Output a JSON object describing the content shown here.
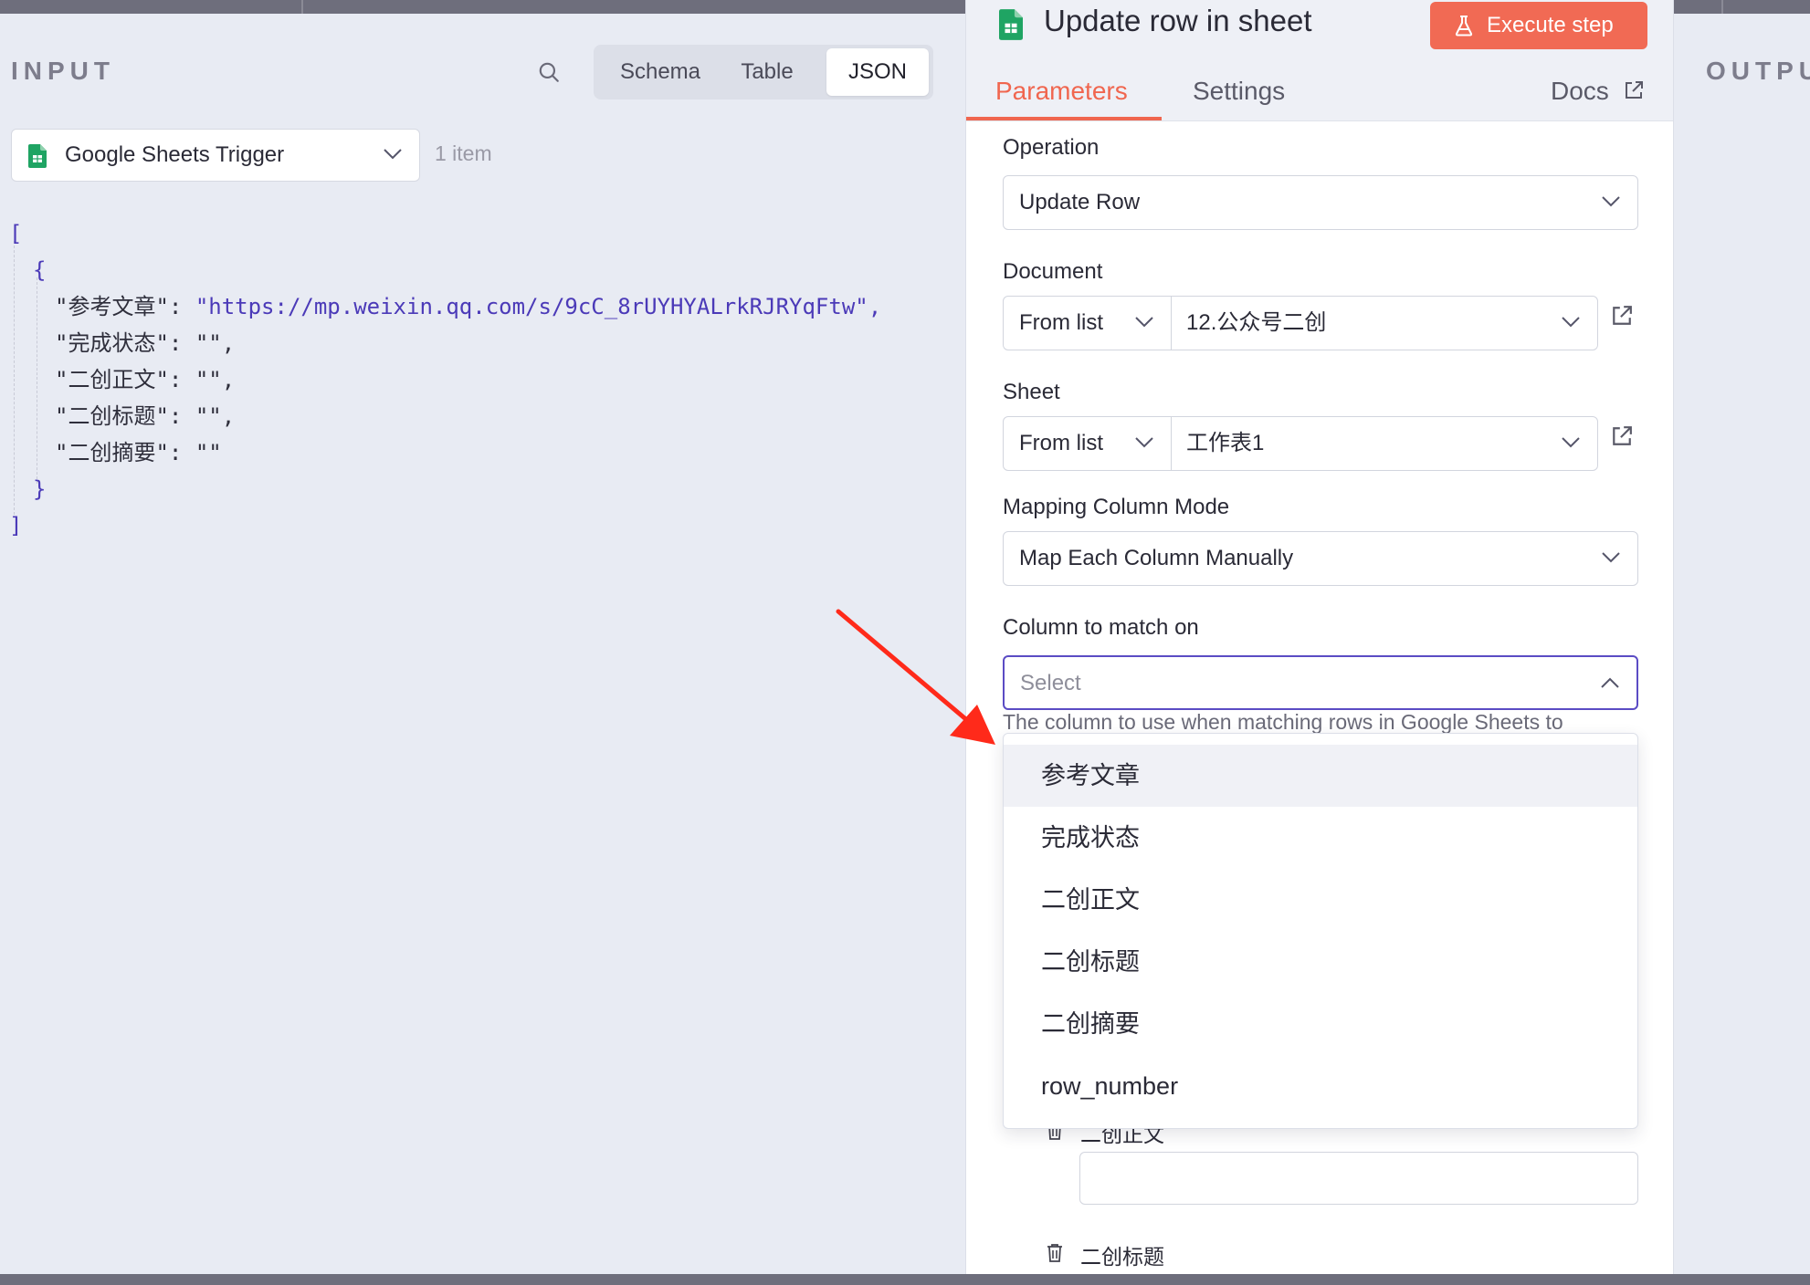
{
  "input_panel": {
    "title": "INPUT",
    "view_tabs": [
      {
        "label": "Schema",
        "active": false
      },
      {
        "label": "Table",
        "active": false
      },
      {
        "label": "JSON",
        "active": true
      }
    ],
    "trigger_select": {
      "label": "Google Sheets Trigger"
    },
    "item_count": "1 item",
    "json": {
      "open_array": "[",
      "open_obj": "{",
      "rows": [
        {
          "key": "\"参考文章\":",
          "value": "\"https://mp.weixin.qq.com/s/9cC_8rUYHYALrkRJRYqFtw\",",
          "is_url": true
        },
        {
          "key": "\"完成状态\":",
          "value": "\"\",",
          "is_url": false
        },
        {
          "key": "\"二创正文\":",
          "value": "\"\",",
          "is_url": false
        },
        {
          "key": "\"二创标题\":",
          "value": "\"\",",
          "is_url": false
        },
        {
          "key": "\"二创摘要\":",
          "value": "\"\"",
          "is_url": false
        }
      ],
      "close_obj": "}",
      "close_array": "]"
    }
  },
  "output_panel": {
    "title": "OUTPU"
  },
  "node_panel": {
    "title": "Update row in sheet",
    "execute_label": "Execute step",
    "tabs": [
      {
        "label": "Parameters",
        "active": true
      },
      {
        "label": "Settings",
        "active": false
      }
    ],
    "docs_label": "Docs",
    "fields": {
      "operation": {
        "label": "Operation",
        "value": "Update Row"
      },
      "document": {
        "label": "Document",
        "mode": "From list",
        "value": "12.公众号二创"
      },
      "sheet": {
        "label": "Sheet",
        "mode": "From list",
        "value": "工作表1"
      },
      "mapping_mode": {
        "label": "Mapping Column Mode",
        "value": "Map Each Column Manually"
      },
      "match_column": {
        "label": "Column to match on",
        "placeholder": "Select",
        "hint": "The column to use when matching rows in Google Sheets to",
        "options": [
          "参考文章",
          "完成状态",
          "二创正文",
          "二创标题",
          "二创摘要",
          "row_number"
        ],
        "hovered_option": "参考文章"
      }
    },
    "mapped_columns": [
      {
        "label": "二创正文"
      },
      {
        "label": "二创标题"
      }
    ]
  },
  "colors": {
    "accent": "#f0664f",
    "focus": "#5b4cc4",
    "json_string": "#4b3ab8",
    "sheets_green": "#1fa463"
  }
}
